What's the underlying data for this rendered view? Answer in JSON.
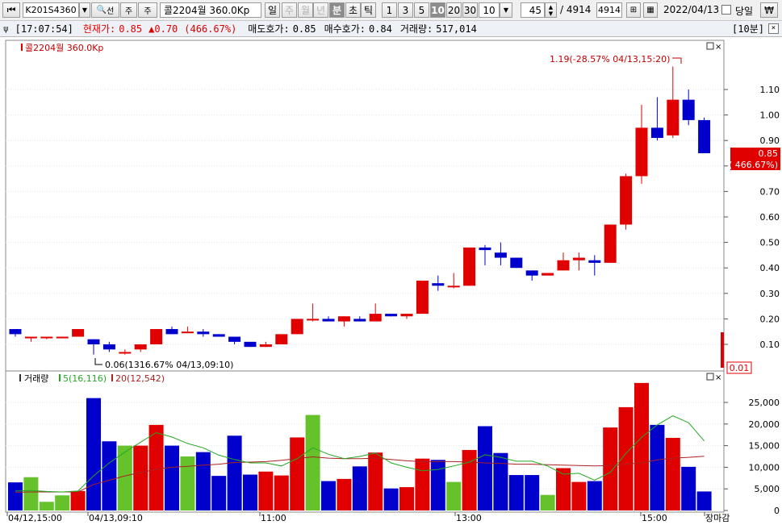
{
  "toolbar": {
    "code": "K201S4360",
    "search_label": "선",
    "refresh_label": "주",
    "option_label": "주",
    "item_name": "콜2204월  360.0Kp",
    "periods": [
      "일",
      "주",
      "월",
      "년",
      "분",
      "초",
      "틱"
    ],
    "minute_options": [
      "1",
      "3",
      "5",
      "10",
      "20",
      "30"
    ],
    "minute_select": "10",
    "count": "45",
    "total_label": "/ 4914",
    "total_box": "4914",
    "date": "2022/04/13",
    "today_label": "당일",
    "won_icon_label": "₩"
  },
  "infobar": {
    "time": "[17:07:54]",
    "cur_label": "현재가:",
    "cur_value": "0.85",
    "change": "▲0.70",
    "change_pct": "(466.67%)",
    "ask_label": "매도호가:",
    "ask_value": "0.85",
    "bid_label": "매수호가:",
    "bid_value": "0.84",
    "vol_label": "거래량:",
    "vol_value": "517,014",
    "interval": "[10분]"
  },
  "price_panel": {
    "title": "콜2204월 360.0Kp",
    "high_note": "1.19(-28.57% 04/13,15:20)",
    "low_note": "0.06(1316.67% 04/13,09:10)",
    "cur_box_line1": "0.85",
    "cur_box_line2": "( 466.67%)",
    "last_box": "0.01",
    "y_ticks": [
      "1.10",
      "1.00",
      "0.90",
      "0.80",
      "0.70",
      "0.60",
      "0.50",
      "0.40",
      "0.30",
      "0.20",
      "0.10"
    ]
  },
  "volume_panel": {
    "title": "거래량",
    "ma5_label": "5(16,116)",
    "ma20_label": "20(12,542)",
    "y_ticks": [
      "25,000",
      "20,000",
      "15,000",
      "10,000",
      "5,000",
      "0"
    ]
  },
  "x_labels": [
    "04/12,15:00",
    "04/13,09:10",
    "11:00",
    "13:00",
    "15:00",
    "장마감"
  ],
  "colors": {
    "up": "#e00000",
    "down": "#0000cc",
    "vol_green": "#66c22a",
    "ma5": "#22aa22",
    "ma20": "#aa2222"
  },
  "chart_data": {
    "type": "candlestick",
    "ylim": [
      0,
      1.2
    ],
    "candles": [
      {
        "o": 0.16,
        "h": 0.16,
        "l": 0.13,
        "c": 0.14
      },
      {
        "o": 0.13,
        "h": 0.13,
        "l": 0.11,
        "c": 0.13
      },
      {
        "o": 0.13,
        "h": 0.13,
        "l": 0.12,
        "c": 0.13
      },
      {
        "o": 0.13,
        "h": 0.13,
        "l": 0.13,
        "c": 0.13
      },
      {
        "o": 0.13,
        "h": 0.16,
        "l": 0.13,
        "c": 0.16
      },
      {
        "o": 0.12,
        "h": 0.12,
        "l": 0.06,
        "c": 0.1
      },
      {
        "o": 0.1,
        "h": 0.11,
        "l": 0.07,
        "c": 0.08
      },
      {
        "o": 0.07,
        "h": 0.08,
        "l": 0.06,
        "c": 0.07
      },
      {
        "o": 0.08,
        "h": 0.1,
        "l": 0.07,
        "c": 0.1
      },
      {
        "o": 0.1,
        "h": 0.16,
        "l": 0.1,
        "c": 0.16
      },
      {
        "o": 0.16,
        "h": 0.17,
        "l": 0.14,
        "c": 0.14
      },
      {
        "o": 0.15,
        "h": 0.17,
        "l": 0.15,
        "c": 0.15
      },
      {
        "o": 0.15,
        "h": 0.16,
        "l": 0.13,
        "c": 0.14
      },
      {
        "o": 0.14,
        "h": 0.14,
        "l": 0.13,
        "c": 0.13
      },
      {
        "o": 0.13,
        "h": 0.13,
        "l": 0.1,
        "c": 0.11
      },
      {
        "o": 0.11,
        "h": 0.11,
        "l": 0.09,
        "c": 0.09
      },
      {
        "o": 0.09,
        "h": 0.11,
        "l": 0.09,
        "c": 0.1
      },
      {
        "o": 0.1,
        "h": 0.14,
        "l": 0.1,
        "c": 0.14
      },
      {
        "o": 0.14,
        "h": 0.2,
        "l": 0.14,
        "c": 0.2
      },
      {
        "o": 0.2,
        "h": 0.26,
        "l": 0.19,
        "c": 0.2
      },
      {
        "o": 0.2,
        "h": 0.21,
        "l": 0.19,
        "c": 0.19
      },
      {
        "o": 0.19,
        "h": 0.21,
        "l": 0.17,
        "c": 0.21
      },
      {
        "o": 0.2,
        "h": 0.21,
        "l": 0.19,
        "c": 0.19
      },
      {
        "o": 0.19,
        "h": 0.26,
        "l": 0.19,
        "c": 0.22
      },
      {
        "o": 0.22,
        "h": 0.22,
        "l": 0.21,
        "c": 0.21
      },
      {
        "o": 0.21,
        "h": 0.22,
        "l": 0.2,
        "c": 0.22
      },
      {
        "o": 0.22,
        "h": 0.35,
        "l": 0.22,
        "c": 0.35
      },
      {
        "o": 0.34,
        "h": 0.37,
        "l": 0.31,
        "c": 0.33
      },
      {
        "o": 0.33,
        "h": 0.38,
        "l": 0.32,
        "c": 0.33
      },
      {
        "o": 0.33,
        "h": 0.48,
        "l": 0.33,
        "c": 0.48
      },
      {
        "o": 0.48,
        "h": 0.49,
        "l": 0.41,
        "c": 0.47
      },
      {
        "o": 0.46,
        "h": 0.5,
        "l": 0.41,
        "c": 0.44
      },
      {
        "o": 0.44,
        "h": 0.44,
        "l": 0.4,
        "c": 0.4
      },
      {
        "o": 0.39,
        "h": 0.39,
        "l": 0.35,
        "c": 0.37
      },
      {
        "o": 0.37,
        "h": 0.38,
        "l": 0.37,
        "c": 0.38
      },
      {
        "o": 0.39,
        "h": 0.46,
        "l": 0.39,
        "c": 0.43
      },
      {
        "o": 0.43,
        "h": 0.46,
        "l": 0.39,
        "c": 0.44
      },
      {
        "o": 0.43,
        "h": 0.45,
        "l": 0.37,
        "c": 0.42
      },
      {
        "o": 0.42,
        "h": 0.57,
        "l": 0.42,
        "c": 0.57
      },
      {
        "o": 0.57,
        "h": 0.77,
        "l": 0.55,
        "c": 0.76
      },
      {
        "o": 0.76,
        "h": 1.04,
        "l": 0.73,
        "c": 0.95
      },
      {
        "o": 0.95,
        "h": 1.07,
        "l": 0.9,
        "c": 0.91
      },
      {
        "o": 0.92,
        "h": 1.19,
        "l": 0.91,
        "c": 1.06
      },
      {
        "o": 1.06,
        "h": 1.1,
        "l": 0.96,
        "c": 0.98
      },
      {
        "o": 0.98,
        "h": 0.99,
        "l": 0.85,
        "c": 0.85
      }
    ],
    "volumes": [
      6500,
      7700,
      2000,
      3500,
      4500,
      26000,
      16000,
      15000,
      15000,
      19800,
      15000,
      12500,
      13500,
      8000,
      17300,
      8300,
      9000,
      8100,
      16900,
      22100,
      6800,
      7300,
      10200,
      13400,
      5100,
      5400,
      12000,
      11700,
      6600,
      14000,
      19500,
      13300,
      8200,
      8200,
      3600,
      9800,
      6600,
      6800,
      19200,
      23900,
      29500,
      19800,
      16800,
      10100,
      4400
    ],
    "volume_colors": [
      "down",
      "green",
      "green",
      "green",
      "up",
      "down",
      "down",
      "green",
      "up",
      "up",
      "down",
      "green",
      "down",
      "down",
      "down",
      "down",
      "up",
      "up",
      "up",
      "green",
      "down",
      "up",
      "down",
      "up",
      "down",
      "up",
      "up",
      "down",
      "green",
      "up",
      "down",
      "down",
      "down",
      "down",
      "green",
      "up",
      "up",
      "down",
      "up",
      "up",
      "up",
      "down",
      "up",
      "down",
      "down"
    ],
    "ma5": [
      4500,
      4600,
      4400,
      4300,
      4500,
      8000,
      11000,
      13500,
      15800,
      18000,
      17000,
      15500,
      14500,
      12800,
      11800,
      11000,
      11000,
      10300,
      12000,
      14500,
      13000,
      12000,
      12500,
      13300,
      11000,
      10000,
      9200,
      9500,
      10300,
      11200,
      12900,
      12300,
      11400,
      11400,
      10300,
      8400,
      8600,
      7000,
      8800,
      13200,
      16900,
      19800,
      21900,
      20300,
      16100
    ],
    "ma20": [
      4200,
      4300,
      4300,
      4300,
      4300,
      6000,
      7000,
      8000,
      8800,
      9500,
      10000,
      10200,
      10500,
      10700,
      11100,
      11200,
      11300,
      11600,
      12000,
      12400,
      12100,
      12000,
      12000,
      12100,
      11800,
      11500,
      11300,
      11300,
      11300,
      11200,
      11000,
      10900,
      10700,
      10700,
      10600,
      10500,
      10400,
      10300,
      10400,
      10700,
      11000,
      11700,
      12100,
      12300,
      12542
    ]
  }
}
